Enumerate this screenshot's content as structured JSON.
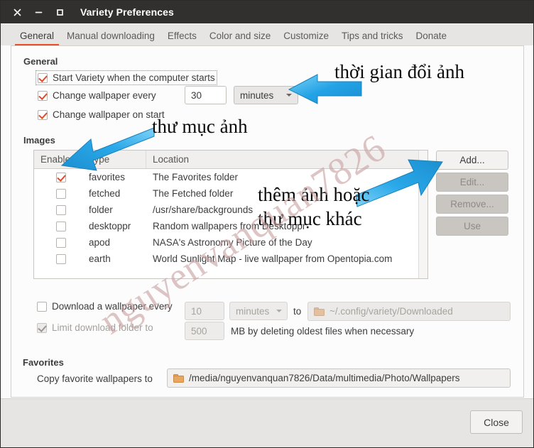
{
  "window": {
    "title": "Variety Preferences",
    "controls": {
      "close": "close-icon",
      "minimize": "minimize-icon",
      "maximize": "maximize-icon"
    }
  },
  "tabs": [
    {
      "label": "General",
      "active": true
    },
    {
      "label": "Manual downloading",
      "active": false
    },
    {
      "label": "Effects",
      "active": false
    },
    {
      "label": "Color and size",
      "active": false
    },
    {
      "label": "Customize",
      "active": false
    },
    {
      "label": "Tips and tricks",
      "active": false
    },
    {
      "label": "Donate",
      "active": false
    }
  ],
  "general": {
    "heading": "General",
    "start_on_boot": {
      "label": "Start Variety when the computer starts",
      "checked": true
    },
    "change_every": {
      "label": "Change wallpaper every",
      "checked": true,
      "value": "30",
      "unit": "minutes"
    },
    "change_on_start": {
      "label": "Change wallpaper on start",
      "checked": true
    }
  },
  "images": {
    "heading": "Images",
    "columns": [
      "Enabled",
      "Type",
      "Location"
    ],
    "rows": [
      {
        "enabled": true,
        "type": "favorites",
        "location": "The Favorites folder"
      },
      {
        "enabled": false,
        "type": "fetched",
        "location": "The Fetched folder"
      },
      {
        "enabled": false,
        "type": "folder",
        "location": "/usr/share/backgrounds"
      },
      {
        "enabled": false,
        "type": "desktoppr",
        "location": "Random wallpapers from Desktoppr"
      },
      {
        "enabled": false,
        "type": "apod",
        "location": "NASA's Astronomy Picture of the Day"
      },
      {
        "enabled": false,
        "type": "earth",
        "location": "World Sunlight Map - live wallpaper from Opentopia.com"
      }
    ],
    "buttons": [
      {
        "label": "Add...",
        "enabled": true
      },
      {
        "label": "Edit...",
        "enabled": false
      },
      {
        "label": "Remove...",
        "enabled": false
      },
      {
        "label": "Use",
        "enabled": false
      }
    ]
  },
  "download": {
    "every": {
      "label": "Download a wallpaper every",
      "checked": false,
      "value": "10",
      "unit": "minutes"
    },
    "to_label": "to",
    "to_path": "~/.config/variety/Downloaded",
    "limit": {
      "label": "Limit download folder to",
      "checked": true,
      "value": "500",
      "suffix": "MB by deleting oldest files when necessary"
    }
  },
  "favorites": {
    "heading": "Favorites",
    "copy_label": "Copy favorite wallpapers to",
    "path": "/media/nguyenvanquan7826/Data/multimedia/Photo/Wallpapers"
  },
  "actions": {
    "close_label": "Close"
  },
  "annotations": [
    {
      "text": "thời gian đổi ảnh"
    },
    {
      "text": "thư mục ảnh"
    },
    {
      "text": "thêm ảnh hoặc"
    },
    {
      "text": "thư mục khác"
    }
  ],
  "watermark": {
    "text": "nguyenvanquan7826"
  },
  "colors": {
    "titlebar": "#32302f",
    "accent": "#e8502a",
    "check": "#e0492a",
    "arrow": "#29a7e8",
    "watermark": "#c9a3a3"
  }
}
